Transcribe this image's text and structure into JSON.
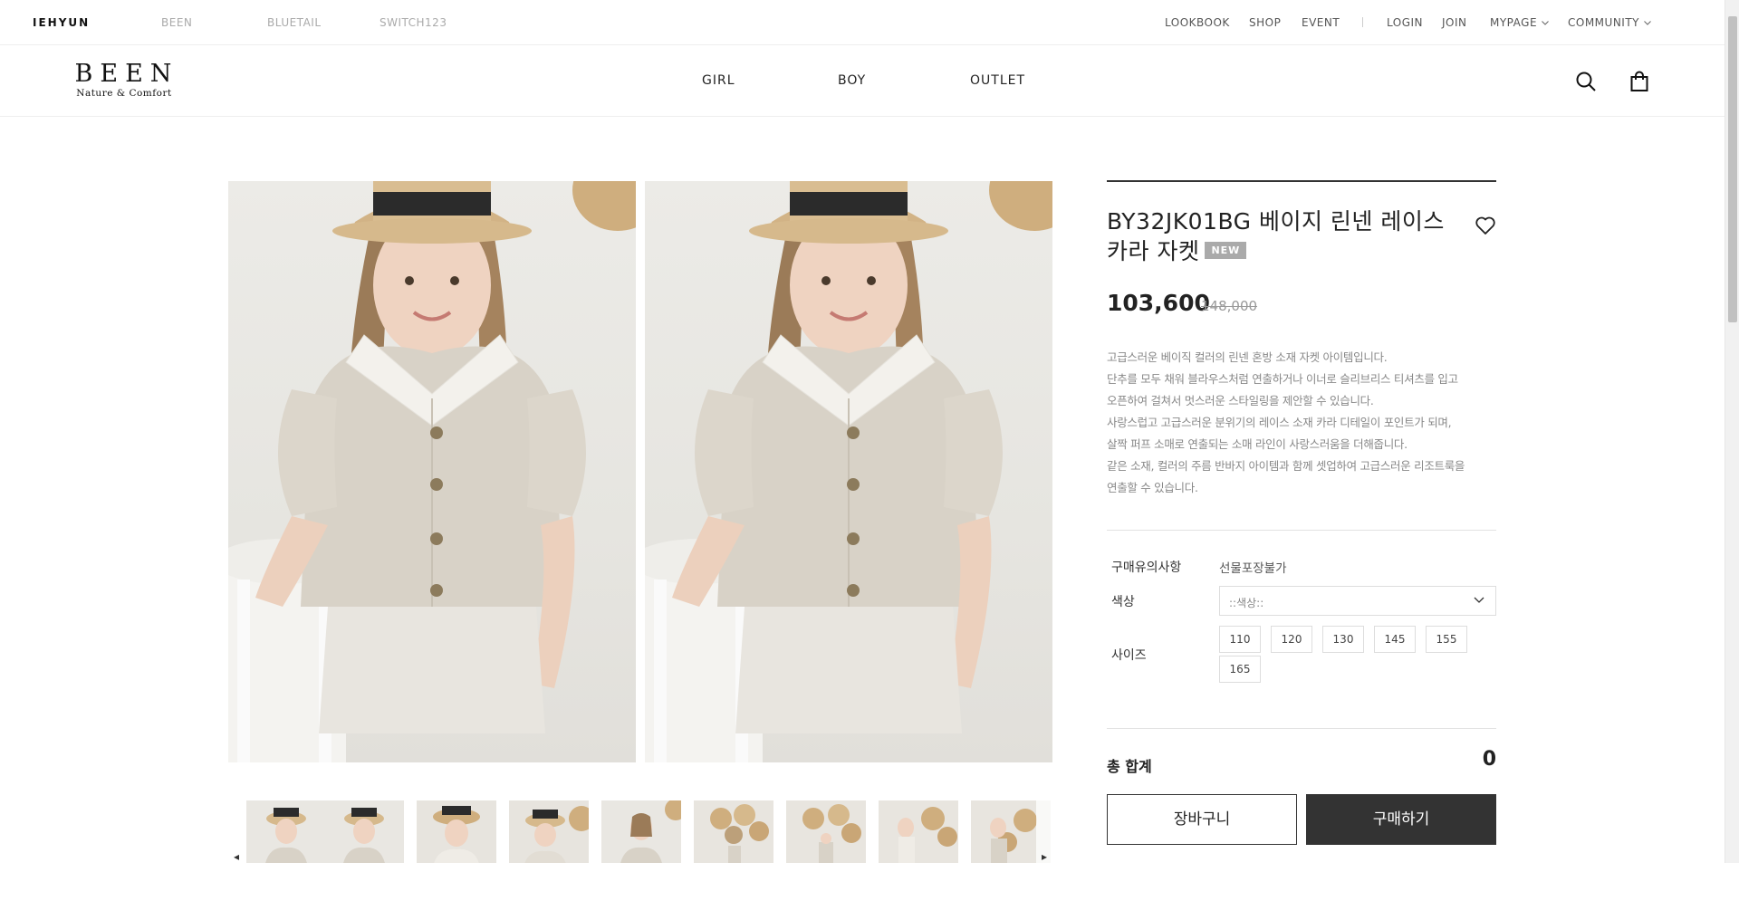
{
  "topbar": {
    "brands": [
      "IEHYUN",
      "BEEN",
      "BLUETAIL",
      "SWITCH123"
    ],
    "links": [
      "LOOKBOOK",
      "SHOP",
      "EVENT",
      "LOGIN",
      "JOIN",
      "MYPAGE",
      "COMMUNITY"
    ]
  },
  "header": {
    "logo_main": "BEEN",
    "logo_sub": "Nature & Comfort",
    "nav": [
      "GIRL",
      "BOY",
      "OUTLET"
    ]
  },
  "product": {
    "title": "BY32JK01BG 베이지 린넨 레이스 카라 자켓",
    "badge": "NEW",
    "price": "103,600",
    "original_price": "148,000",
    "description": [
      "고급스러운 베이직 컬러의 린넨 혼방 소재 자켓 아이템입니다.",
      "단추를 모두 채워 블라우스처럼 연출하거나 이너로 슬리브리스 티셔츠를 입고",
      "오픈하여 걸쳐서 멋스러운 스타일링을 제안할 수 있습니다.",
      "사랑스럽고 고급스러운 분위기의 레이스 소재 카라 디테일이 포인트가 되며,",
      "살짝 퍼프 소매로 연출되는 소매 라인이 사랑스러움을 더해줍니다.",
      "같은 소재, 컬러의 주름 반바지 아이템과 함께 셋업하여 고급스러운 리조트룩을",
      "연출할 수 있습니다."
    ],
    "notice_label": "구매유의사항",
    "notice_value": "선물포장불가",
    "color_label": "색상",
    "color_placeholder": "::색상::",
    "size_label": "사이즈",
    "sizes": [
      "110",
      "120",
      "130",
      "145",
      "155",
      "165"
    ],
    "total_label": "총 합계",
    "total_value": "0",
    "cart_button": "장바구니",
    "buy_button": "구매하기"
  },
  "colors": {
    "accent_dark": "#333333",
    "badge_gray": "#aaaaaa",
    "border": "#dddddd"
  },
  "icons": [
    "search-icon",
    "shopping-bag-icon",
    "heart-icon",
    "chevron-down-icon",
    "arrow-left-icon",
    "arrow-right-icon"
  ]
}
